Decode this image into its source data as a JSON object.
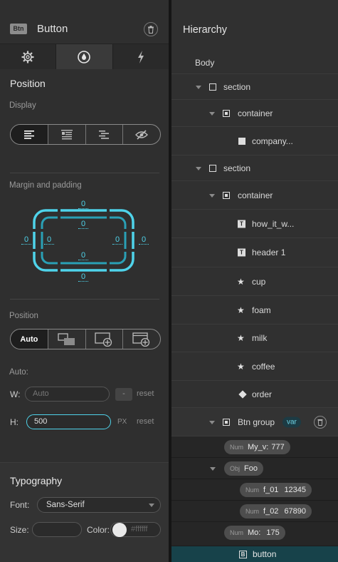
{
  "left": {
    "header": {
      "badge": "Btn",
      "title": "Button",
      "icons": {
        "delete": "trash-icon"
      }
    },
    "tabs": [
      {
        "name": "settings",
        "icon": "gear-icon",
        "active": false
      },
      {
        "name": "style",
        "icon": "droplet-icon",
        "active": true
      },
      {
        "name": "events",
        "icon": "lightning-icon",
        "active": false
      }
    ],
    "position_section": {
      "title": "Position",
      "display_label": "Display",
      "display_options": [
        "block-icon",
        "flex-icon",
        "inline-icon",
        "hidden-icon"
      ],
      "margin_label": "Margin and padding",
      "margin": {
        "top": "0",
        "right": "0",
        "bottom": "0",
        "left": "0"
      },
      "padding": {
        "top": "0",
        "right": "0",
        "bottom": "0",
        "left": "0"
      },
      "position_label": "Position",
      "position_options": {
        "auto": "Auto"
      },
      "auto_label": "Auto:",
      "width": {
        "label": "W:",
        "placeholder": "Auto",
        "unit": "-",
        "reset": "reset"
      },
      "height": {
        "label": "H:",
        "value": "500",
        "unit": "PX",
        "reset": "reset"
      }
    },
    "typography": {
      "title": "Typography",
      "font_label": "Font:",
      "font_value": "Sans-Serif",
      "size_label": "Size:",
      "color_label": "Color:",
      "color_placeholder": "#ffffff"
    }
  },
  "right": {
    "title": "Hierarchy",
    "tree": {
      "body": "Body",
      "section1": "section",
      "container1": "container",
      "company": "company...",
      "section2": "section",
      "container2": "container",
      "how": "how_it_w...",
      "header1": "header 1",
      "cup": "cup",
      "foam": "foam",
      "milk": "milk",
      "coffee": "coffee",
      "order": "order",
      "btn_group": "Btn group",
      "var_badge": "var",
      "button": "button"
    },
    "variables": {
      "my_v": {
        "type": "Num",
        "name": "My_v:",
        "value": "777"
      },
      "foo": {
        "type": "Obj",
        "name": "Foo"
      },
      "f01": {
        "type": "Num",
        "name": "f_01",
        "value": "12345"
      },
      "f02": {
        "type": "Num",
        "name": "f_02",
        "value": "67890"
      },
      "mo": {
        "type": "Num",
        "name": "Mo:",
        "value": "175"
      }
    }
  },
  "colors": {
    "accent": "#4fd3ea",
    "selected_row": "#17424a",
    "background": "#2f2f2f"
  }
}
